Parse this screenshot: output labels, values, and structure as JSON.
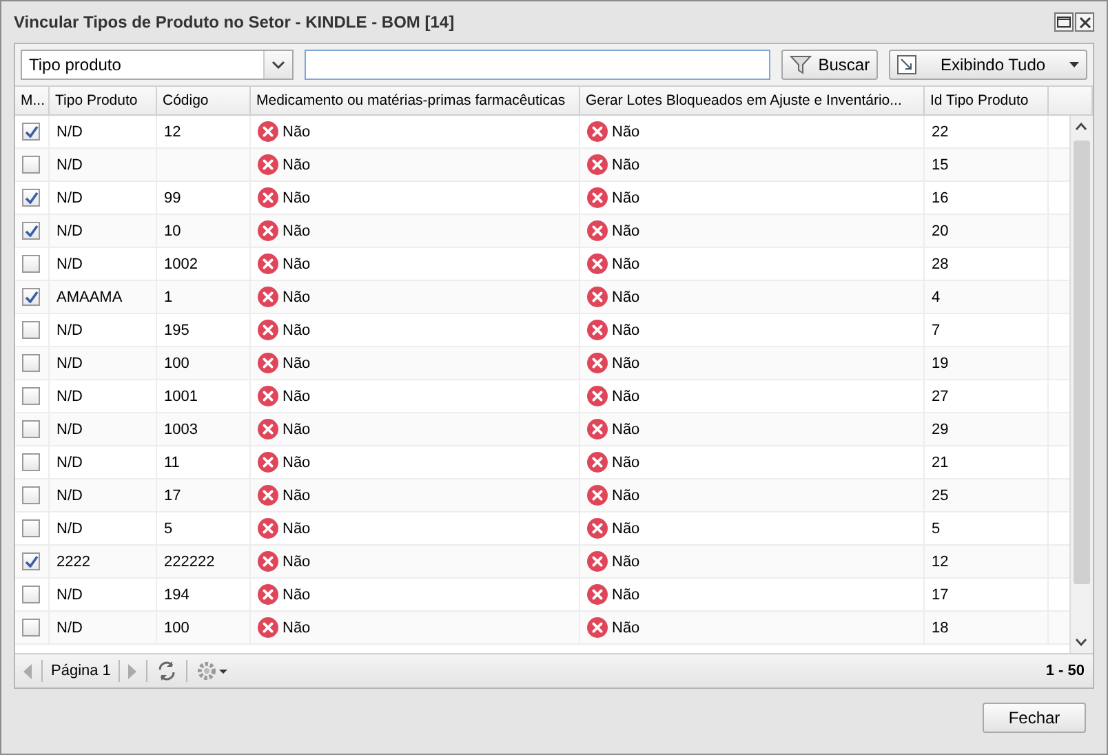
{
  "window": {
    "title": "Vincular Tipos de Produto no Setor - KINDLE - BOM [14]"
  },
  "toolbar": {
    "filter_field": "Tipo produto",
    "search_button": "Buscar",
    "view_button": "Exibindo Tudo"
  },
  "table": {
    "columns": [
      "M...",
      "Tipo Produto",
      "Código",
      "Medicamento ou matérias-primas farmacêuticas",
      "Gerar Lotes Bloqueados em Ajuste e Inventário...",
      "Id Tipo Produto"
    ],
    "rows": [
      {
        "checked": true,
        "tipo": "N/D",
        "codigo": "12",
        "medicamento": "Não",
        "gerar_lotes": "Não",
        "id": "22"
      },
      {
        "checked": false,
        "tipo": "N/D",
        "medicamento": "Não",
        "gerar_lotes": "Não",
        "id": "15"
      },
      {
        "checked": true,
        "tipo": "N/D",
        "codigo": "99",
        "medicamento": "Não",
        "gerar_lotes": "Não",
        "id": "16"
      },
      {
        "checked": true,
        "tipo": "N/D",
        "codigo": "10",
        "medicamento": "Não",
        "gerar_lotes": "Não",
        "id": "20"
      },
      {
        "checked": false,
        "tipo": "N/D",
        "codigo": "1002",
        "medicamento": "Não",
        "gerar_lotes": "Não",
        "id": "28"
      },
      {
        "checked": true,
        "tipo": "AMAAMA",
        "codigo": "1",
        "medicamento": "Não",
        "gerar_lotes": "Não",
        "id": "4"
      },
      {
        "checked": false,
        "tipo": "N/D",
        "codigo": "195",
        "medicamento": "Não",
        "gerar_lotes": "Não",
        "id": "7"
      },
      {
        "checked": false,
        "tipo": "N/D",
        "codigo": "100",
        "medicamento": "Não",
        "gerar_lotes": "Não",
        "id": "19"
      },
      {
        "checked": false,
        "tipo": "N/D",
        "codigo": "1001",
        "medicamento": "Não",
        "gerar_lotes": "Não",
        "id": "27"
      },
      {
        "checked": false,
        "tipo": "N/D",
        "codigo": "1003",
        "medicamento": "Não",
        "gerar_lotes": "Não",
        "id": "29"
      },
      {
        "checked": false,
        "tipo": "N/D",
        "codigo": "11",
        "medicamento": "Não",
        "gerar_lotes": "Não",
        "id": "21"
      },
      {
        "checked": false,
        "tipo": "N/D",
        "codigo": "17",
        "medicamento": "Não",
        "gerar_lotes": "Não",
        "id": "25"
      },
      {
        "checked": false,
        "tipo": "N/D",
        "codigo": "5",
        "medicamento": "Não",
        "gerar_lotes": "Não",
        "id": "5"
      },
      {
        "checked": true,
        "tipo": "2222",
        "codigo": "222222",
        "medicamento": "Não",
        "gerar_lotes": "Não",
        "id": "12"
      },
      {
        "checked": false,
        "tipo": "N/D",
        "codigo": "194",
        "medicamento": "Não",
        "gerar_lotes": "Não",
        "id": "17"
      },
      {
        "checked": false,
        "tipo": "N/D",
        "codigo": "100",
        "medicamento": "Não",
        "gerar_lotes": "Não",
        "id": "18"
      }
    ]
  },
  "pager": {
    "page_label": "Página 1",
    "range": "1 - 50"
  },
  "buttons": [
    "Fechar"
  ]
}
